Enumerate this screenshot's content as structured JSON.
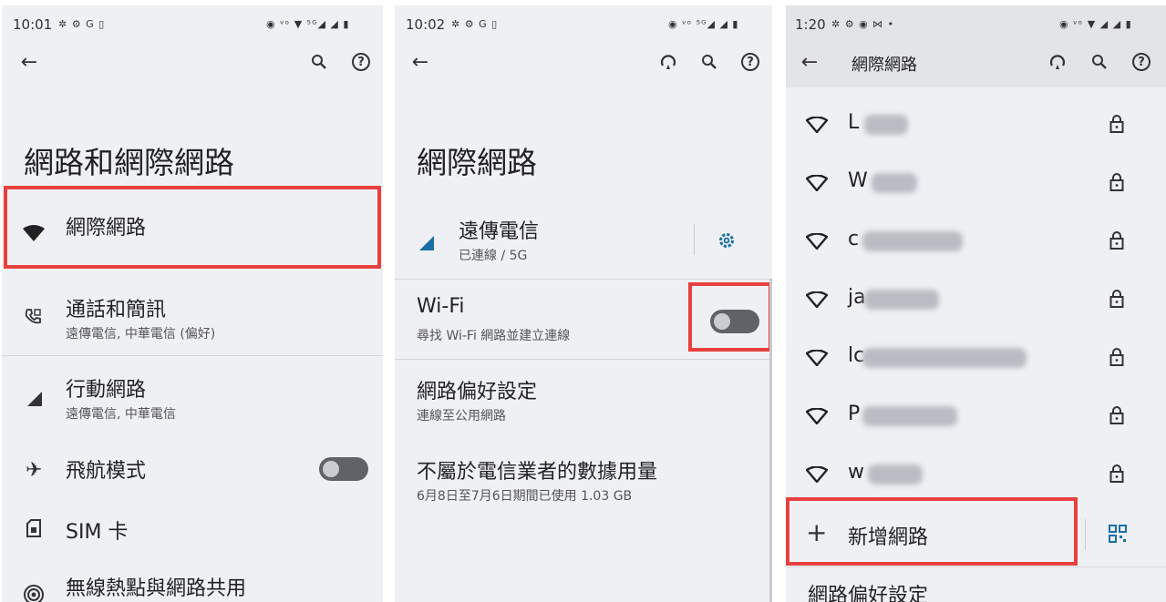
{
  "panel1": {
    "status_time": "10:01",
    "status_icons": "✲ ⚙ G ▯",
    "status_right": "◉ ᵛᵒ ▼ ⁵ᴳ◢ ◢ ▮",
    "title": "網路和網際網路",
    "items": [
      {
        "label": "網際網路",
        "sub": ""
      },
      {
        "label": "通話和簡訊",
        "sub": "遠傳電信, 中華電信 (偏好)"
      },
      {
        "label": "行動網路",
        "sub": "遠傳電信, 中華電信"
      },
      {
        "label": "飛航模式",
        "sub": ""
      },
      {
        "label": "SIM 卡",
        "sub": ""
      },
      {
        "label": "無線熱點與網路共用",
        "sub": ""
      }
    ],
    "airplane_toggle": "off"
  },
  "panel2": {
    "status_time": "10:02",
    "status_icons": "✲ ⚙ G ▯",
    "status_right": "◉ ᵛᵒ ⁵ᴳ◢ ◢ ▮",
    "title": "網際網路",
    "carrier": {
      "label": "遠傳電信",
      "sub": "已連線 / 5G"
    },
    "wifi": {
      "label": "Wi-Fi",
      "sub": "尋找 Wi-Fi 網路並建立連線",
      "toggle": "off"
    },
    "prefs": {
      "label": "網路偏好設定",
      "sub": "連線至公用網路"
    },
    "usage": {
      "label": "不屬於電信業者的數據用量",
      "sub": "6月8日至7月6日期間已使用 1.03 GB"
    }
  },
  "panel3": {
    "status_time": "1:20",
    "status_icons": "✲ ⚙ ◉ ⋈ •",
    "status_right": "◉ ᵛᵒ ▼ ◢ ◢ ▮",
    "header_title": "網際網路",
    "networks": [
      {
        "ssid_visible": "L"
      },
      {
        "ssid_visible": "W"
      },
      {
        "ssid_visible": "c"
      },
      {
        "ssid_visible": "ja"
      },
      {
        "ssid_visible": "lc"
      },
      {
        "ssid_visible": "P"
      },
      {
        "ssid_visible": "w"
      }
    ],
    "add_network": "新增網路",
    "prefs_partial": "網路偏好設定"
  },
  "colors": {
    "panel_bg": "#eef0f3",
    "highlight": "#e8403e",
    "accent": "#1a6fa6",
    "toggle_off": "#5f6367"
  }
}
